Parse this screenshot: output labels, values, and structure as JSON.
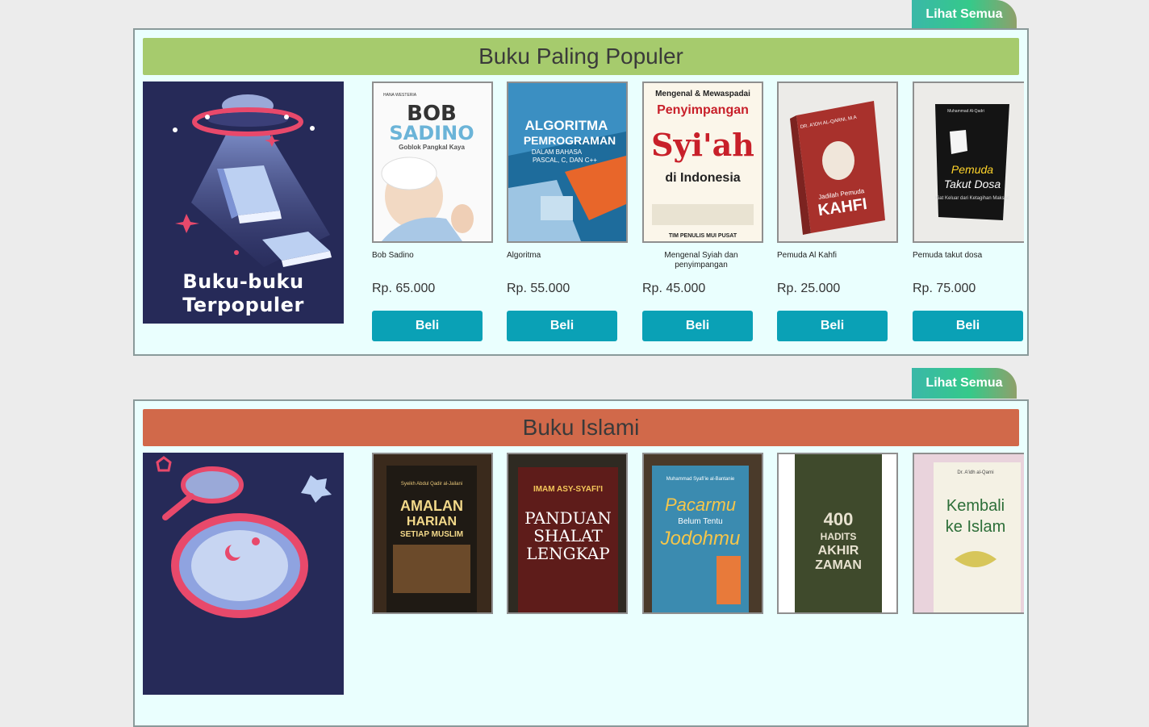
{
  "sections": [
    {
      "see_all": "Lihat Semua",
      "title": "Buku Paling Populer",
      "banner_color": "#a6cb6d",
      "promo_line1": "Buku-buku",
      "promo_line2": "Terpopuler",
      "products": [
        {
          "name": "Bob Sadino",
          "price": "Rp. 65.000",
          "buy": "Beli",
          "cover": {
            "t1": "BOB",
            "t2": "SADINO",
            "t3": "Goblok Pangkal Kaya",
            "top": "HANA WESTERIA"
          }
        },
        {
          "name": "Algoritma",
          "price": "Rp. 55.000",
          "buy": "Beli",
          "cover": {
            "t1": "ALGORITMA",
            "t2": "PEMROGRAMAN",
            "t3": "DALAM BAHASA",
            "t4": "PASCAL, C, DAN C++"
          }
        },
        {
          "name": "Mengenal Syiah dan penyimpangan",
          "price": "Rp. 45.000",
          "buy": "Beli",
          "cover": {
            "t1": "Mengenal & Mewaspadai",
            "t2": "Penyimpangan",
            "t3": "Syi'ah",
            "t4": "di Indonesia",
            "t5": "TIM PENULIS MUI PUSAT"
          }
        },
        {
          "name": "Pemuda Al Kahfi",
          "price": "Rp. 25.000",
          "buy": "Beli",
          "cover": {
            "t1": "DR. A'IDH AL-QARNI, M.A",
            "t2": "Jadilah Pemuda",
            "t3": "KAHFI"
          }
        },
        {
          "name": "Pemuda takut dosa",
          "price": "Rp. 75.000",
          "buy": "Beli",
          "cover": {
            "t1": "Muhammad Al-Qadri",
            "t2": "Pemuda",
            "t3": "Takut Dosa",
            "t4": "Kiat Keluar dari Ketagihan Maksiat"
          }
        }
      ]
    },
    {
      "see_all": "Lihat Semua",
      "title": "Buku Islami",
      "banner_color": "#d1694a",
      "products": [
        {
          "name": "Amalan Harian Setiap Muslim",
          "cover": {
            "t1": "Syeikh Abdul Qadir al-Jailani",
            "t2": "AMALAN",
            "t3": "HARIAN",
            "t4": "SETIAP MUSLIM"
          }
        },
        {
          "name": "Panduan Shalat Lengkap",
          "cover": {
            "t1": "IMAM ASY-SYAFI'I",
            "t2": "PANDUAN",
            "t3": "SHALAT",
            "t4": "LENGKAP"
          }
        },
        {
          "name": "Pacarmu Belum Tentu Jodohmu",
          "cover": {
            "t1": "Muhammad Syafi'ie al-Bantanie",
            "t2": "Pacarmu",
            "t3": "Belum Tentu",
            "t4": "Jodohmu"
          }
        },
        {
          "name": "400 Hadits Akhir Zaman",
          "cover": {
            "t1": "400",
            "t2": "HADITS",
            "t3": "AKHIR",
            "t4": "ZAMAN"
          }
        },
        {
          "name": "Kembali ke Islam",
          "cover": {
            "t1": "Dr. A'idh al-Qarni",
            "t2": "Kembali",
            "t3": "ke Islam"
          }
        }
      ]
    }
  ],
  "colors": {
    "buy_button": "#0aa1b6",
    "box_bg": "#eafffe",
    "promo_bg": "#262a58"
  },
  "icons": [
    "ufo-illustration",
    "magnifier-illustration"
  ]
}
